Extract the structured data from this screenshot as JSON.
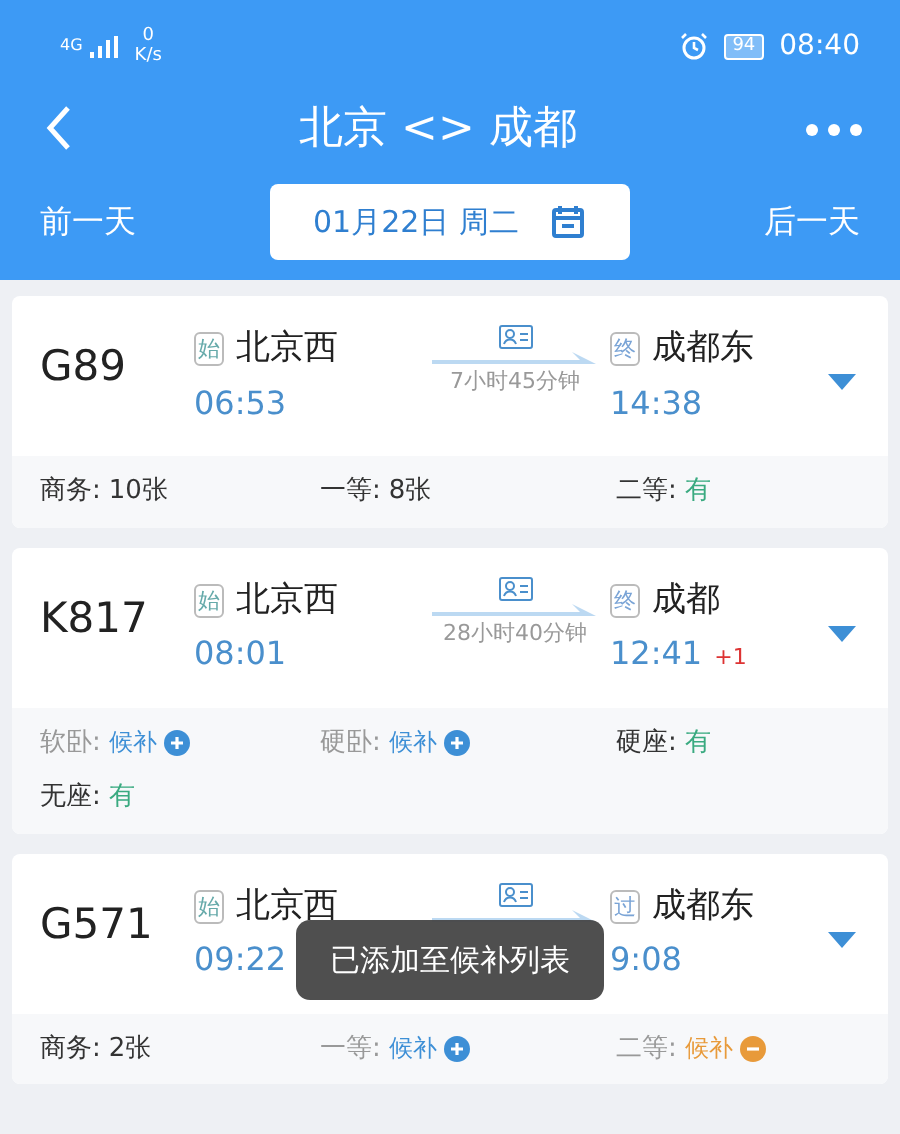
{
  "status_bar": {
    "network": "4G",
    "speed": "0",
    "speed_unit": "K/s",
    "battery": "94",
    "time": "08:40"
  },
  "header": {
    "title": "北京 <> 成都",
    "prev_day": "前一天",
    "date": "01月22日 周二",
    "next_day": "后一天"
  },
  "trains": [
    {
      "number": "G89",
      "from_tag": "始",
      "from": "北京西",
      "depart": "06:53",
      "duration": "7小时45分钟",
      "to_tag": "终",
      "to": "成都东",
      "arrive": "14:38",
      "seats": [
        {
          "label": "商务:",
          "value": "10张",
          "kind": "count",
          "disabled": false
        },
        {
          "label": "一等:",
          "value": "8张",
          "kind": "count",
          "disabled": false
        },
        {
          "label": "二等:",
          "value": "有",
          "kind": "available",
          "disabled": false
        }
      ]
    },
    {
      "number": "K817",
      "from_tag": "始",
      "from": "北京西",
      "depart": "08:01",
      "duration": "28小时40分钟",
      "to_tag": "终",
      "to": "成都",
      "arrive": "12:41",
      "day_offset": "+1",
      "seats": [
        {
          "label": "软卧:",
          "value": "候补",
          "kind": "waitlist",
          "disabled": true
        },
        {
          "label": "硬卧:",
          "value": "候补",
          "kind": "waitlist",
          "disabled": true
        },
        {
          "label": "硬座:",
          "value": "有",
          "kind": "available",
          "disabled": false
        },
        {
          "label": "无座:",
          "value": "有",
          "kind": "available",
          "disabled": false
        }
      ]
    },
    {
      "number": "G571",
      "from_tag": "始",
      "from": "北京西",
      "depart": "09:22",
      "to_tag": "过",
      "to": "成都东",
      "arrive": "9:08",
      "seats": [
        {
          "label": "商务:",
          "value": "2张",
          "kind": "count",
          "disabled": false
        },
        {
          "label": "一等:",
          "value": "候补",
          "kind": "waitlist",
          "disabled": true
        },
        {
          "label": "二等:",
          "value": "候补",
          "kind": "waitlisted",
          "disabled": true
        }
      ]
    }
  ],
  "toast": "已添加至候补列表"
}
